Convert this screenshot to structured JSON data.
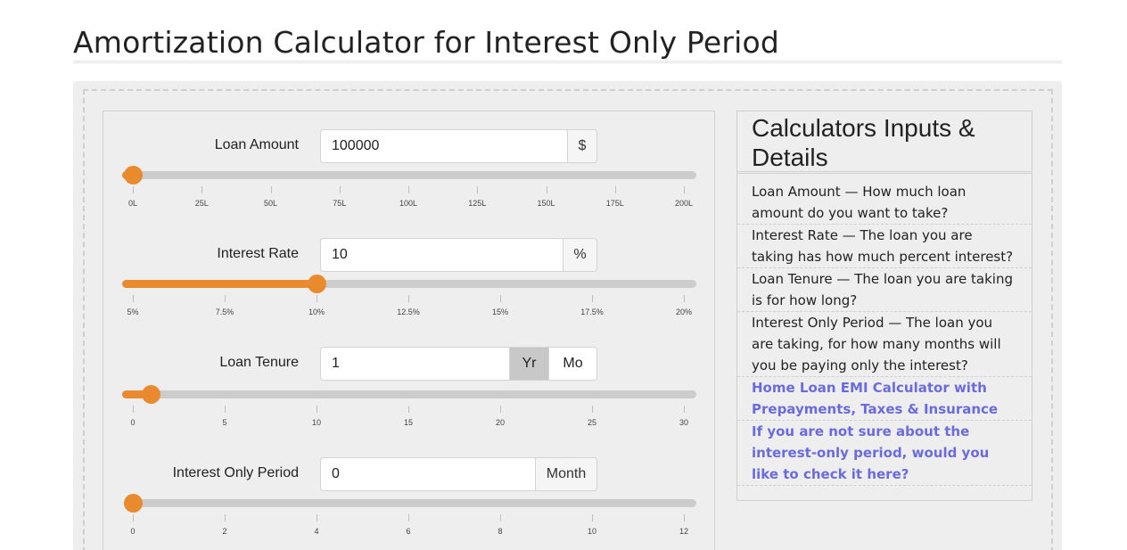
{
  "page": {
    "title": "Amortization Calculator for Interest Only Period"
  },
  "calculator": {
    "loan_amount": {
      "label": "Loan Amount",
      "value": "100000",
      "addon": "$",
      "slider_fraction": 0.0,
      "ticks": [
        "0L",
        "25L",
        "50L",
        "75L",
        "100L",
        "125L",
        "150L",
        "175L",
        "200L"
      ]
    },
    "interest_rate": {
      "label": "Interest Rate",
      "value": "10",
      "addon": "%",
      "slider_fraction": 0.333,
      "ticks": [
        "5%",
        "7.5%",
        "10%",
        "12.5%",
        "15%",
        "17.5%",
        "20%"
      ]
    },
    "loan_tenure": {
      "label": "Loan Tenure",
      "value": "1",
      "toggle_year": "Yr",
      "toggle_month": "Mo",
      "selected": "Yr",
      "slider_fraction": 0.033,
      "ticks": [
        "0",
        "5",
        "10",
        "15",
        "20",
        "25",
        "30"
      ]
    },
    "interest_only_period": {
      "label": "Interest Only Period",
      "value": "0",
      "addon": "Month",
      "slider_fraction": 0.0,
      "ticks": [
        "0",
        "2",
        "4",
        "6",
        "8",
        "10",
        "12"
      ]
    }
  },
  "info": {
    "title": "Calculators Inputs & Details",
    "items": [
      {
        "text": "Loan Amount — How much loan amount do you want to take?",
        "link": false
      },
      {
        "text": "Interest Rate — The loan you are taking has how much percent interest?",
        "link": false
      },
      {
        "text": "Loan Tenure — The loan you are taking is for how long?",
        "link": false
      },
      {
        "text": "Interest Only Period — The loan you are taking, for how many months will you be paying only the interest?",
        "link": false
      },
      {
        "text": "Home Loan EMI Calculator with Prepayments, Taxes & Insurance",
        "link": true
      },
      {
        "text": "If you are not sure about the interest-only period, would you like to check it here?",
        "link": true
      }
    ]
  },
  "colors": {
    "accent": "#ea8a2e",
    "link": "#6b6bdd",
    "panel_bg": "#eeeeee"
  }
}
